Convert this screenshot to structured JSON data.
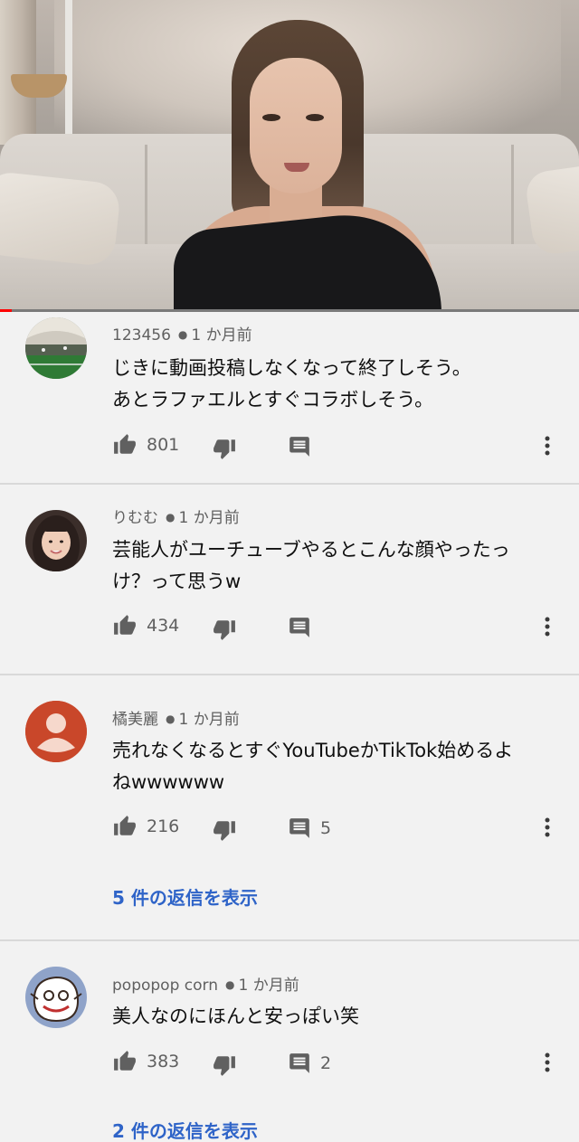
{
  "video": {
    "progress_fraction": 0.02
  },
  "comments": [
    {
      "author": "123456",
      "time": "1 か月前",
      "lines": [
        "じきに動画投稿しなくなって終了しそう。",
        "あとラファエルとすぐコラボしそう。"
      ],
      "likes": "801",
      "replies_count": "",
      "avatar": "stadium-photo"
    },
    {
      "author": "りむむ",
      "time": "1 か月前",
      "lines": [
        "芸能人がユーチューブやるとこんな顔やったっ",
        "け？って思うw"
      ],
      "likes": "434",
      "replies_count": "",
      "avatar": "girl-photo"
    },
    {
      "author": "橘美麗",
      "time": "1 か月前",
      "lines": [
        "売れなくなるとすぐYouTubeかTikTok始めるよ",
        "ねwwwwww"
      ],
      "likes": "216",
      "replies_count": "5",
      "view_replies": "5 件の返信を表示",
      "avatar": "default-profile"
    },
    {
      "author": "popopop corn",
      "time": "1 か月前",
      "lines": [
        "美人なのにほんと安っぽい笑"
      ],
      "likes": "383",
      "replies_count": "2",
      "view_replies": "2 件の返信を表示",
      "avatar": "cartoon-drawing"
    }
  ],
  "colors": {
    "background": "#f2f2f2",
    "link_blue": "#2f64c8",
    "meta_gray": "#606060",
    "icon_gray": "#606060",
    "default_avatar": "#c9472a",
    "progress_red": "#ff0000"
  }
}
